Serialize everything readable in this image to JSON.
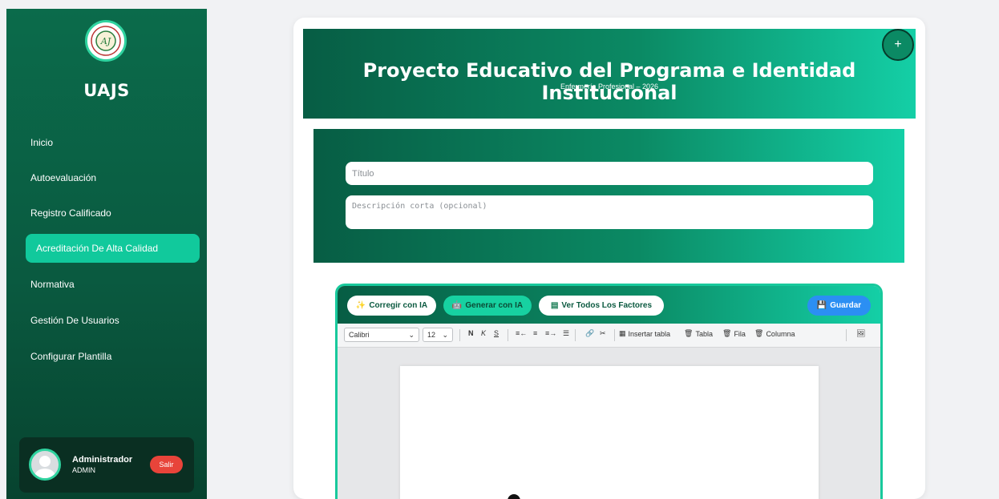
{
  "sidebar": {
    "brand": "UAJS",
    "logo_text": "AJ",
    "items": [
      {
        "label": "Inicio"
      },
      {
        "label": "Autoevaluación"
      },
      {
        "label": "Registro Calificado"
      },
      {
        "label": "Acreditación De Alta Calidad",
        "active": true
      },
      {
        "label": "Normativa"
      },
      {
        "label": "Gestión De Usuarios"
      },
      {
        "label": "Configurar Plantilla"
      }
    ],
    "user": {
      "name": "Administrador",
      "role": "ADMIN",
      "logout_label": "Salir"
    }
  },
  "header": {
    "title": "Proyecto Educativo del Programa e Identidad Institucional",
    "subtitle": "Enfermería Profesional – 2026",
    "plus_label": "+"
  },
  "form": {
    "title_placeholder": "Título",
    "description_placeholder": "Descripción corta (opcional)"
  },
  "editor": {
    "ai_buttons": {
      "correct": "Corregir con IA",
      "generate": "Generar con IA",
      "factors": "Ver Todos Los Factores",
      "save": "Guardar"
    },
    "toolbar": {
      "font": "Calibri",
      "size": "12",
      "bold": "N",
      "italic": "K",
      "strike": "S",
      "insert_table": "Insertar tabla",
      "delete_table": "Tabla",
      "delete_row": "Fila",
      "delete_column": "Columna"
    }
  },
  "colors": {
    "primary_dark": "#0a5a40",
    "accent": "#11c99c",
    "danger": "#e8443a",
    "save_blue": "#2b8ff3"
  }
}
